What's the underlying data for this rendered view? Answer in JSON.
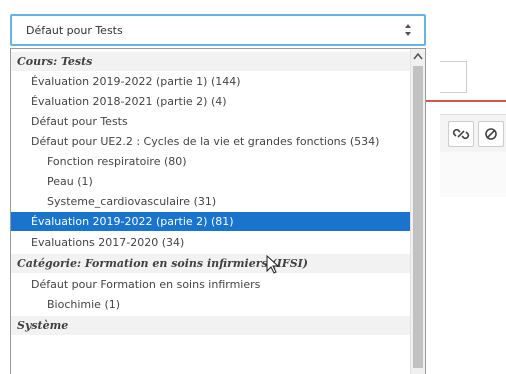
{
  "select": {
    "value": "Défaut pour Tests",
    "arrow_icon": "up-down-arrow-icon"
  },
  "dropdown": {
    "groups": [
      {
        "label": "Cours: Tests",
        "options": [
          {
            "label": "Évaluation 2019-2022 (partie 1) (144)",
            "level": 1
          },
          {
            "label": "Évaluation 2018-2021 (partie 2) (4)",
            "level": 1
          },
          {
            "label": "Défaut pour Tests",
            "level": 1
          },
          {
            "label": "Défaut pour UE2.2 : Cycles de la vie et grandes fonctions (534)",
            "level": 1
          },
          {
            "label": "Fonction respiratoire (80)",
            "level": 2
          },
          {
            "label": "Peau (1)",
            "level": 2
          },
          {
            "label": "Systeme_cardiovasculaire (31)",
            "level": 2
          },
          {
            "label": "Évaluation 2019-2022 (partie 2) (81)",
            "level": 1,
            "selected": true
          },
          {
            "label": "Evaluations 2017-2020 (34)",
            "level": 1
          }
        ]
      },
      {
        "label": "Catégorie: Formation en soins infirmiers (IFSI)",
        "options": [
          {
            "label": "Défaut pour Formation en soins infirmiers",
            "level": 1
          },
          {
            "label": "Biochimie (1)",
            "level": 2
          }
        ]
      },
      {
        "label": "Système",
        "options": []
      }
    ]
  },
  "background": {
    "toolbar_icons": [
      "link-icon",
      "unlink-icon"
    ],
    "accent_color": "#d9534f"
  },
  "colors": {
    "selected_bg": "#1874cd",
    "focus_border": "#66b3e8"
  }
}
